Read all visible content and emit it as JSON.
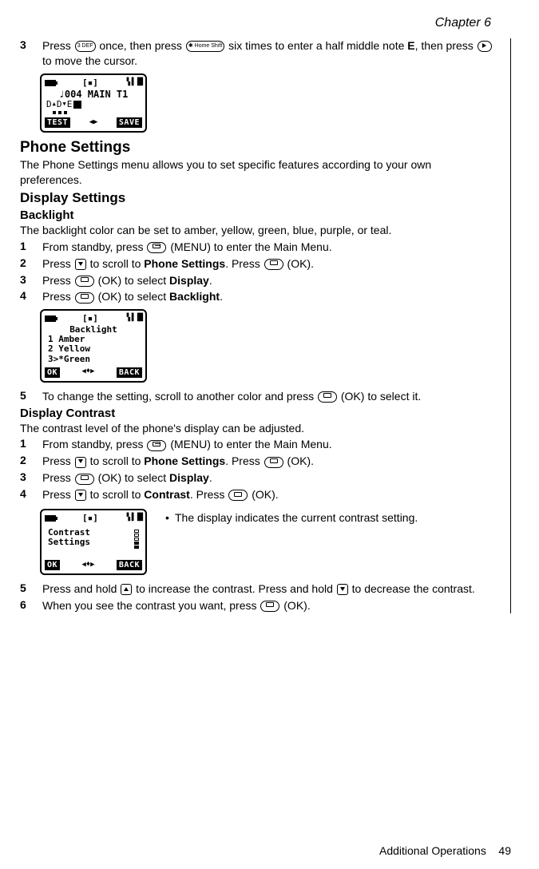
{
  "header": {
    "chapter": "Chapter 6"
  },
  "footer": {
    "section": "Additional Operations",
    "page": "49"
  },
  "steps_a": {
    "s3_num": "3",
    "s3_before": "Press ",
    "s3_key1": "3 DEF",
    "s3_mid1": " once, then press ",
    "s3_key2": "✱ Home Shift",
    "s3_mid2": " six times to enter a half middle note ",
    "s3_bold": "E",
    "s3_mid3": ", then press ",
    "s3_after": " to move the cursor."
  },
  "lcd1": {
    "line1": "♩004 MAIN T1",
    "de_d": "D",
    "de_d2": "D",
    "de_e": "E",
    "btn_left": "TEST",
    "btn_right": "SAVE"
  },
  "sections": {
    "phone_settings_title": "Phone Settings",
    "phone_settings_desc": "The Phone Settings menu allows you to set specific features according to your own preferences.",
    "display_settings_title": "Display Settings",
    "backlight_title": "Backlight",
    "backlight_desc": "The backlight color can be set to amber, yellow, green, blue, purple, or teal.",
    "contrast_title": "Display Contrast",
    "contrast_desc": "The contrast level of the phone's display can be adjusted."
  },
  "steps_b": {
    "s1_num": "1",
    "s1_before": "From standby, press ",
    "s1_after": " (MENU) to enter the Main Menu.",
    "s2_num": "2",
    "s2_before": "Press ",
    "s2_mid1": " to scroll to ",
    "s2_bold": "Phone Settings",
    "s2_mid2": ". Press ",
    "s2_after": " (OK).",
    "s3_num": "3",
    "s3_before": "Press ",
    "s3_mid": " (OK) to select ",
    "s3_bold": "Display",
    "s3_after": ".",
    "s4_num": "4",
    "s4_before": "Press ",
    "s4_mid": " (OK) to select ",
    "s4_bold": "Backlight",
    "s4_after": "."
  },
  "lcd2": {
    "title": "Backlight",
    "line1": "1  Amber",
    "line2": "2  Yellow",
    "line3": "3>*Green",
    "btn_left": "OK",
    "btn_right": "BACK"
  },
  "steps_c": {
    "s5_num": "5",
    "s5_before": "To change the setting, scroll to another color and press ",
    "s5_after": " (OK) to select it."
  },
  "steps_d": {
    "s1_num": "1",
    "s1_before": "From standby, press ",
    "s1_after": " (MENU) to enter the Main Menu.",
    "s2_num": "2",
    "s2_before": "Press ",
    "s2_mid1": " to scroll to ",
    "s2_bold": "Phone Settings",
    "s2_mid2": ". Press ",
    "s2_after": " (OK).",
    "s3_num": "3",
    "s3_before": "Press ",
    "s3_mid": " (OK) to select ",
    "s3_bold": "Display",
    "s3_after": ".",
    "s4_num": "4",
    "s4_before": "Press ",
    "s4_mid1": " to scroll to ",
    "s4_bold": "Contrast",
    "s4_mid2": ". Press ",
    "s4_after": " (OK)."
  },
  "lcd3": {
    "line1": "Contrast",
    "line2": "Settings",
    "note": "The display indicates the current contrast setting.",
    "btn_left": "OK",
    "btn_right": "BACK"
  },
  "steps_e": {
    "s5_num": "5",
    "s5_before": "Press and hold ",
    "s5_mid1": " to increase the contrast. Press and hold ",
    "s5_after": " to decrease the contrast.",
    "s6_num": "6",
    "s6_before": "When you see the contrast you want, press ",
    "s6_after": " (OK)."
  }
}
